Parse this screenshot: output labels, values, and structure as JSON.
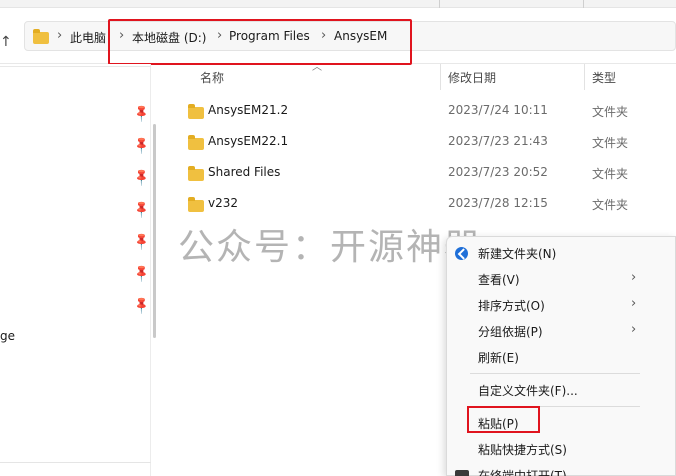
{
  "address_bar": {
    "breadcrumbs": [
      "此电脑",
      "本地磁盘 (D:)",
      "Program Files",
      "AnsysEM"
    ],
    "separator": "›",
    "icon": "folder-icon",
    "up_icon": "arrow-up-icon",
    "highlight_color": "#e0141e"
  },
  "columns": {
    "name": "名称",
    "modified": "修改日期",
    "type": "类型"
  },
  "files": [
    {
      "name": "AnsysEM21.2",
      "modified": "2023/7/24 10:11",
      "type": "文件夹"
    },
    {
      "name": "AnsysEM22.1",
      "modified": "2023/7/23 21:43",
      "type": "文件夹"
    },
    {
      "name": "Shared Files",
      "modified": "2023/7/23 20:52",
      "type": "文件夹"
    },
    {
      "name": "v232",
      "modified": "2023/7/28 12:15",
      "type": "文件夹"
    }
  ],
  "nav_pane": {
    "partial_text": "ge",
    "pin_icon": "pin-icon"
  },
  "watermark": "公众号：开源神器",
  "context_menu": {
    "items": [
      {
        "label": "新建文件夹(N)",
        "icon": "new-folder-icon",
        "submenu": false
      },
      {
        "label": "查看(V)",
        "submenu": true
      },
      {
        "label": "排序方式(O)",
        "submenu": true
      },
      {
        "label": "分组依据(P)",
        "submenu": true
      },
      {
        "label": "刷新(E)",
        "submenu": false
      },
      {
        "label": "自定义文件夹(F)...",
        "submenu": false
      },
      {
        "label": "粘贴(P)",
        "submenu": false,
        "highlighted": true
      },
      {
        "label": "粘贴快捷方式(S)",
        "submenu": false
      },
      {
        "label": "在终端中打开(T)",
        "icon": "terminal-icon",
        "submenu": false
      }
    ],
    "submenu_arrow": "›"
  }
}
